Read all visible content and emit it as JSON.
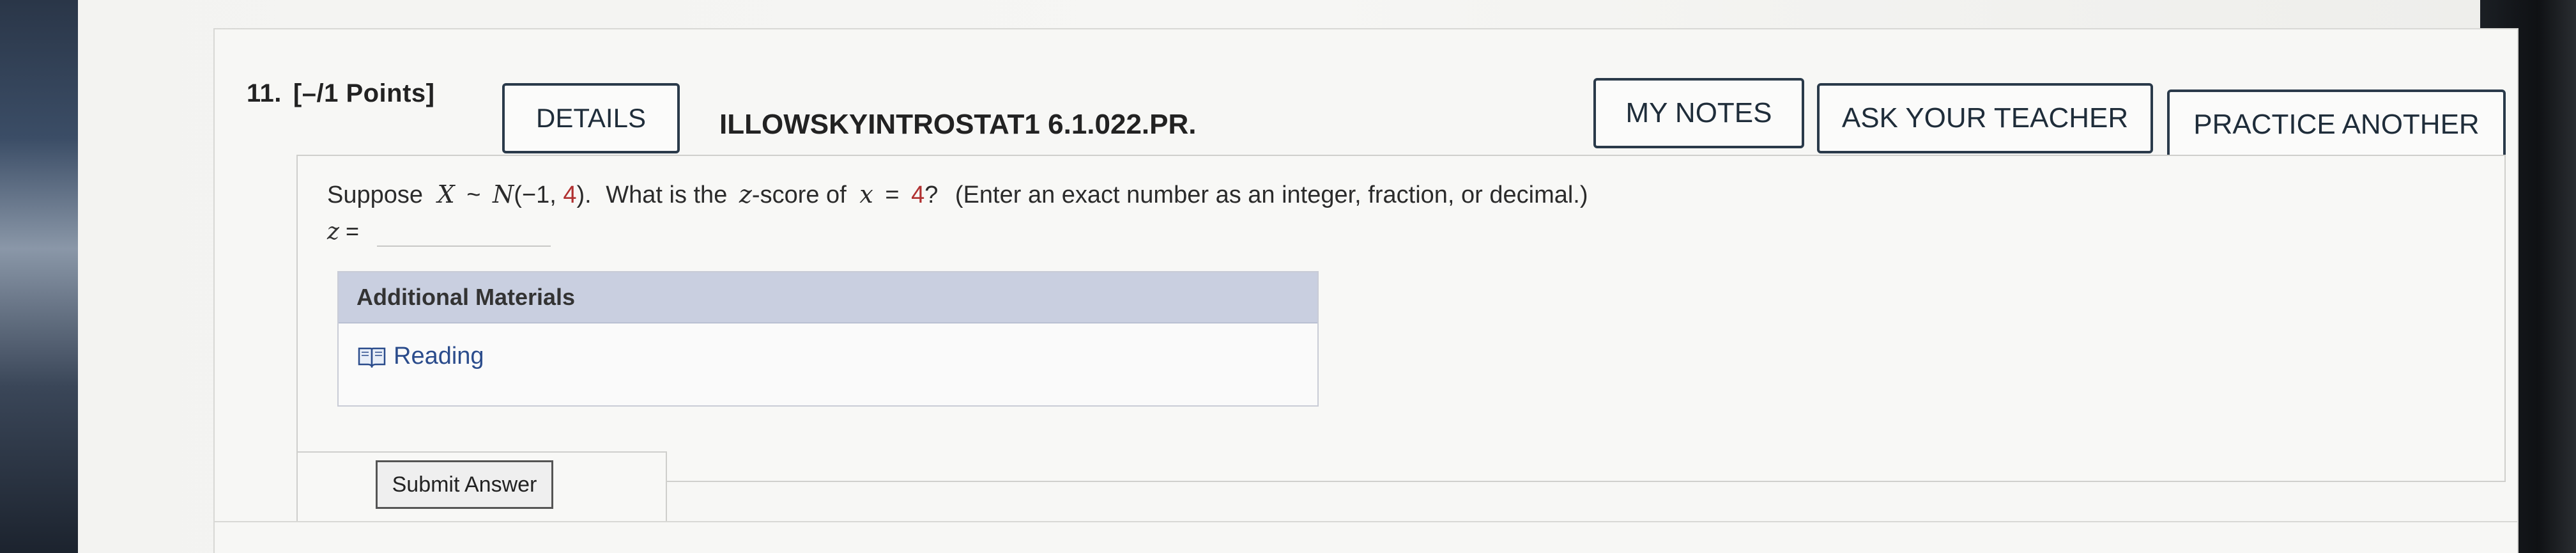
{
  "question": {
    "number_label": "11.",
    "points_label": "[–/1 Points]",
    "details_label": "DETAILS",
    "question_id": "ILLOWSKYINTROSTAT1 6.1.022.PR.",
    "buttons": {
      "my_notes": "MY NOTES",
      "ask_teacher": "ASK YOUR TEACHER",
      "practice_another": "PRACTICE ANOTHER"
    },
    "prompt": {
      "lead": "Suppose",
      "dist_var": "X",
      "tilde": "~",
      "dist_name": "N",
      "param_open": "(−1, ",
      "param_value": "4",
      "param_close": ").",
      "mid_text": "What is the",
      "z_word": "z",
      "z_suffix": "-score of",
      "x_var": "x",
      "equals": "=",
      "x_value": "4",
      "qmark": "?",
      "instruction": "(Enter an exact number as an integer, fraction, or decimal.)"
    },
    "answer": {
      "label_var": "z",
      "label_eq": "=",
      "value": ""
    },
    "additional_materials": {
      "heading": "Additional Materials",
      "reading_label": "Reading"
    },
    "submit_label": "Submit Answer"
  },
  "colors": {
    "highlight_red": "#b03030",
    "materials_header_bg": "#c9cfe0",
    "link_blue": "#2b4c8c"
  },
  "icons": [
    "book-icon"
  ]
}
